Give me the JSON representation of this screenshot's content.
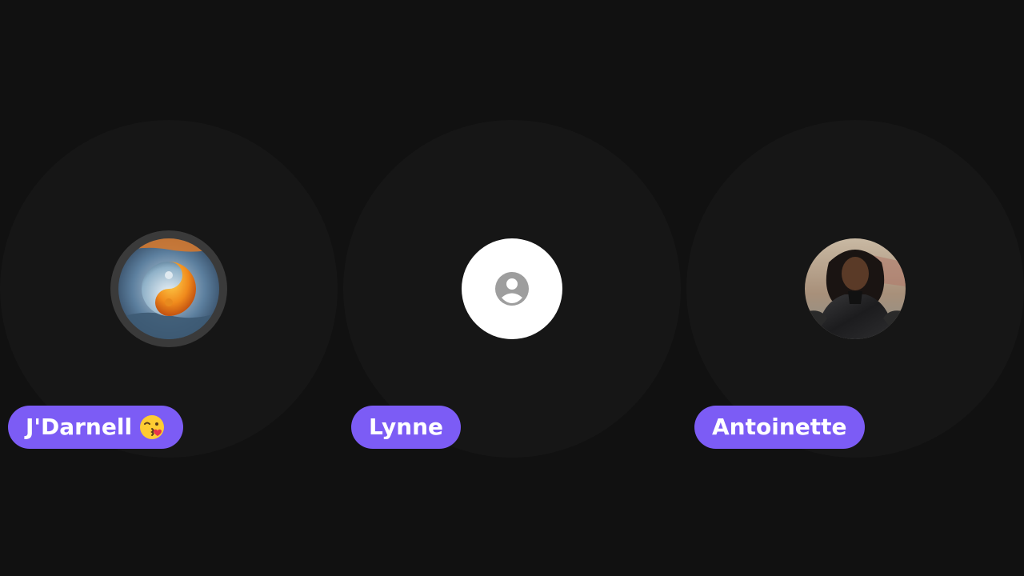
{
  "participants": [
    {
      "name": "J'Darnell",
      "emoji": "😘",
      "avatar": "yin-yang-fire-water-image",
      "speaking": true
    },
    {
      "name": "Lynne",
      "avatar": "default-person-icon",
      "speaking": false
    },
    {
      "name": "Antoinette",
      "avatar": "woman-leather-jacket-photo",
      "speaking": false
    }
  ],
  "colors": {
    "background": "#111111",
    "tile": "#161616",
    "name_pill": "#7c5cf5",
    "speaking_ring": "#3a3a3a",
    "placeholder_bg": "#ffffff",
    "placeholder_icon": "#9e9e9e"
  }
}
